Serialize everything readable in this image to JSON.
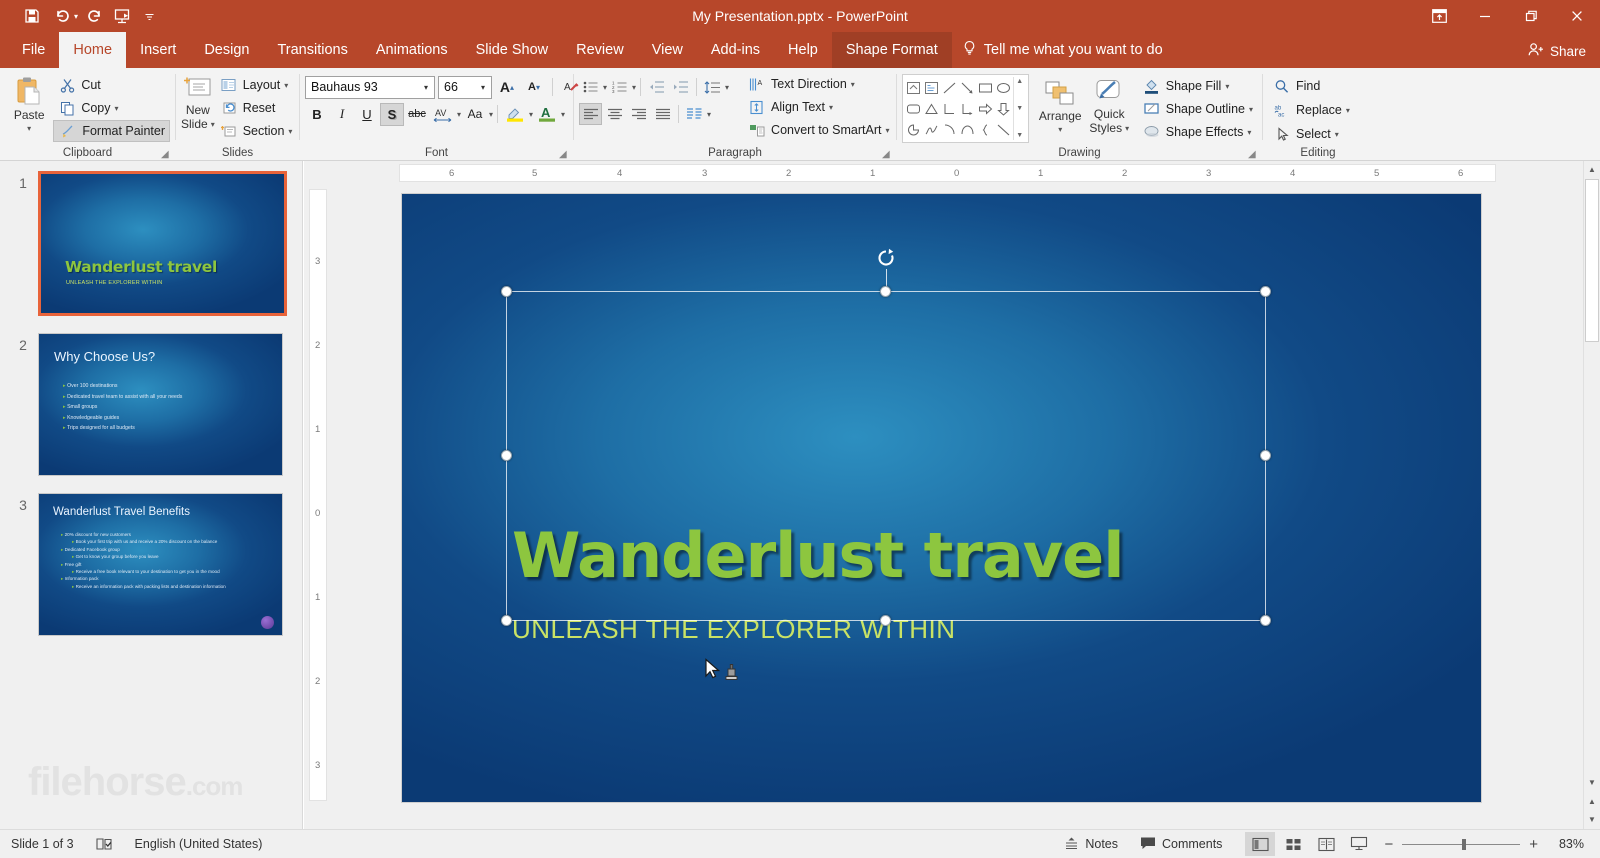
{
  "window": {
    "title": "My Presentation.pptx  -  PowerPoint",
    "accent_color": "#b7472a",
    "quick_access": [
      {
        "name": "save",
        "icon": "save-icon"
      },
      {
        "name": "undo",
        "icon": "undo-icon"
      },
      {
        "name": "redo",
        "icon": "redo-icon"
      },
      {
        "name": "start-slideshow",
        "icon": "slideshow-icon"
      },
      {
        "name": "customize-qat",
        "icon": "chevron-down-icon"
      }
    ],
    "controls": {
      "ribbon_display": "ribbon-display-options-icon",
      "minimize": "minimize-icon",
      "restore": "restore-icon",
      "close": "close-icon"
    },
    "share_label": "Share"
  },
  "tabs": [
    {
      "label": "File",
      "active": false,
      "contextual": false
    },
    {
      "label": "Home",
      "active": true,
      "contextual": false
    },
    {
      "label": "Insert",
      "active": false,
      "contextual": false
    },
    {
      "label": "Design",
      "active": false,
      "contextual": false
    },
    {
      "label": "Transitions",
      "active": false,
      "contextual": false
    },
    {
      "label": "Animations",
      "active": false,
      "contextual": false
    },
    {
      "label": "Slide Show",
      "active": false,
      "contextual": false
    },
    {
      "label": "Review",
      "active": false,
      "contextual": false
    },
    {
      "label": "View",
      "active": false,
      "contextual": false
    },
    {
      "label": "Add-ins",
      "active": false,
      "contextual": false
    },
    {
      "label": "Help",
      "active": false,
      "contextual": false
    },
    {
      "label": "Shape Format",
      "active": false,
      "contextual": true
    }
  ],
  "tellme": "Tell me what you want to do",
  "ribbon": {
    "clipboard": {
      "label": "Clipboard",
      "paste": "Paste",
      "cut": "Cut",
      "copy": "Copy",
      "format_painter": "Format Painter"
    },
    "slides": {
      "label": "Slides",
      "new_slide_line1": "New",
      "new_slide_line2": "Slide",
      "layout": "Layout",
      "reset": "Reset",
      "section": "Section"
    },
    "font": {
      "label": "Font",
      "font_name": "Bauhaus 93",
      "font_size": "66",
      "grow": "A",
      "shrink": "A",
      "clear_formatting": "clear-formatting-icon",
      "bold": "B",
      "italic": "I",
      "underline": "U",
      "shadow": "S",
      "strikethrough": "abc",
      "character_spacing": "AV",
      "change_case": "Aa",
      "text_highlight": "highlight-icon",
      "font_color": "A",
      "shadow_active": true
    },
    "paragraph": {
      "label": "Paragraph",
      "text_direction": "Text Direction",
      "align_text": "Align Text",
      "convert_to_smartart": "Convert to SmartArt"
    },
    "drawing": {
      "label": "Drawing",
      "arrange": "Arrange",
      "quick_styles_line1": "Quick",
      "quick_styles_line2": "Styles",
      "shape_fill": "Shape Fill",
      "shape_outline": "Shape Outline",
      "shape_effects": "Shape Effects"
    },
    "editing": {
      "label": "Editing",
      "find": "Find",
      "replace": "Replace",
      "select": "Select"
    }
  },
  "thumbnails": [
    {
      "number": "1",
      "selected": true,
      "title": "Wanderlust travel",
      "subtitle": "UNLEASH THE EXPLORER WITHIN",
      "bullets": []
    },
    {
      "number": "2",
      "selected": false,
      "title": "Why Choose Us?",
      "subtitle": "",
      "bullets": [
        {
          "text": "Over 100 destinations",
          "level": 1
        },
        {
          "text": "Dedicated travel team to assist with all your needs",
          "level": 1
        },
        {
          "text": "Small groups",
          "level": 1
        },
        {
          "text": "Knowledgeable guides",
          "level": 1
        },
        {
          "text": "Trips designed for all budgets",
          "level": 1
        }
      ]
    },
    {
      "number": "3",
      "selected": false,
      "title": "Wanderlust Travel Benefits",
      "subtitle": "",
      "bullets": [
        {
          "text": "20% discount for new customers",
          "level": 1
        },
        {
          "text": "Book your first trip with us and receive a 20% discount on the balance",
          "level": 2
        },
        {
          "text": "Dedicated Facebook group",
          "level": 1
        },
        {
          "text": "Get to know your group before you leave",
          "level": 2
        },
        {
          "text": "Free gift",
          "level": 1
        },
        {
          "text": "Receive a free book relevant to your destination to get you in the mood",
          "level": 2
        },
        {
          "text": "Information pack",
          "level": 1
        },
        {
          "text": "Receive an information pack with packing lists and destination information",
          "level": 2
        }
      ]
    }
  ],
  "slide": {
    "title": "Wanderlust travel",
    "subtitle": "UNLEASH THE EXPLORER WITHIN",
    "title_color": "#8DC63F",
    "subtitle_color": "#C9E265",
    "background_color": "#0b3a74"
  },
  "rulers": {
    "horizontal": [
      "6",
      "5",
      "4",
      "3",
      "2",
      "1",
      "0",
      "1",
      "2",
      "3",
      "4",
      "5",
      "6"
    ],
    "vertical": [
      "3",
      "2",
      "1",
      "0",
      "1",
      "2",
      "3"
    ]
  },
  "status": {
    "slide_indicator": "Slide 1 of 3",
    "accessibility_icon": "accessibility-checker-icon",
    "language": "English (United States)",
    "notes": "Notes",
    "comments": "Comments",
    "views": [
      {
        "name": "normal-view",
        "active": true
      },
      {
        "name": "slide-sorter-view",
        "active": false
      },
      {
        "name": "reading-view",
        "active": false
      },
      {
        "name": "slideshow-view",
        "active": false
      }
    ],
    "zoom_out": "−",
    "zoom_in": "+",
    "zoom_level": "83%"
  },
  "watermark": {
    "name": "filehorse",
    "suffix": ".com"
  }
}
